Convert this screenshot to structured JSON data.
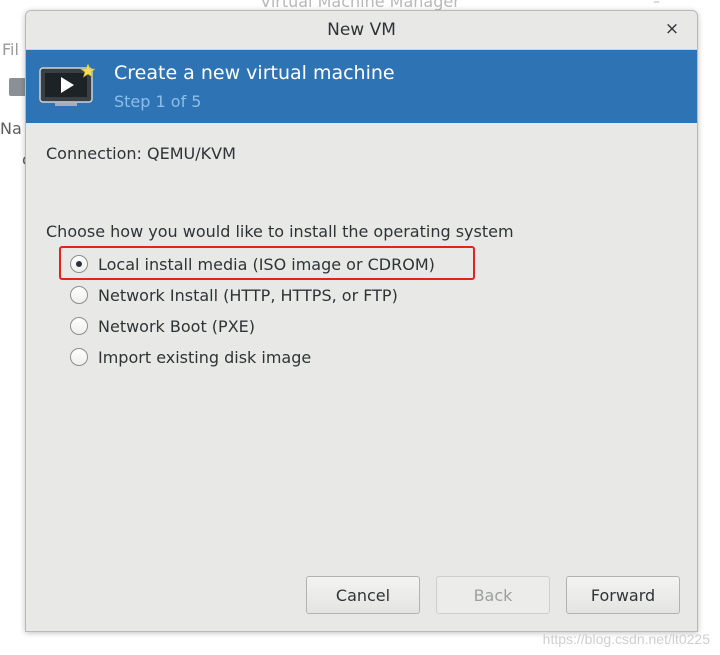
{
  "background_window": {
    "title": "Virtual Machine Manager",
    "menu_file": "Fil",
    "col_name": "Na",
    "cell": "c"
  },
  "dialog": {
    "title": "New VM",
    "close_glyph": "×",
    "banner": {
      "heading": "Create a new virtual machine",
      "step": "Step 1 of 5",
      "icon": "virtual-machine-new-icon"
    },
    "connection_label": "Connection:",
    "connection_value": "QEMU/KVM",
    "install_prompt": "Choose how you would like to install the operating system",
    "options": [
      {
        "label": "Local install media (ISO image or CDROM)",
        "selected": true
      },
      {
        "label": "Network Install (HTTP, HTTPS, or FTP)",
        "selected": false
      },
      {
        "label": "Network Boot (PXE)",
        "selected": false
      },
      {
        "label": "Import existing disk image",
        "selected": false
      }
    ],
    "buttons": {
      "cancel": "Cancel",
      "back": "Back",
      "forward": "Forward"
    }
  },
  "watermark": "https://blog.csdn.net/lt0225",
  "colors": {
    "banner": "#2e74b5",
    "step_text": "#8fbde6",
    "highlight": "#e3231d"
  }
}
